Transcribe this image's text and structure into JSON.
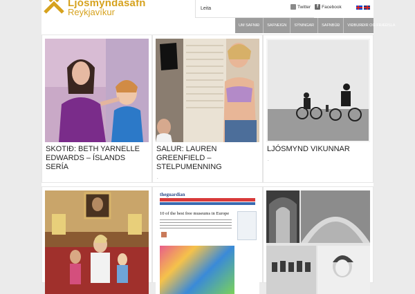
{
  "header": {
    "logo_line1": "Ljósmyndasafn",
    "logo_line2": "Reykjavíkur",
    "logo_color": "#d6a21e",
    "search_label": "Leita",
    "social": [
      {
        "label": "Twitter",
        "icon": "twitter-icon"
      },
      {
        "label": "Facebook",
        "icon": "facebook-icon"
      }
    ],
    "languages": [
      "is-flag-icon",
      "en-flag-icon"
    ]
  },
  "nav": {
    "items": [
      "UM SAFNIÐ",
      "SAFNEIGN",
      "SÝNINGAR",
      "SAFNBÚÐ",
      "VIÐBURÐIR OG FRÆÐSLA"
    ],
    "bg": "#9c9c9c"
  },
  "tiles": [
    {
      "title": "SKOTIÐ: BETH YARNELLE EDWARDS – ÍSLANDS SERÍA",
      "dot": "."
    },
    {
      "title": "SALUR: LAUREN GREENFIELD – STELPUMENNING",
      "dot": "."
    },
    {
      "title": "LJÓSMYND VIKUNNAR",
      "dot": "."
    },
    {
      "title": "",
      "dot": ""
    },
    {
      "title": "",
      "dot": ""
    },
    {
      "title": "",
      "dot": ""
    }
  ],
  "article_preview": {
    "masthead": "theguardian",
    "headline": "10 of the best free museums in Europe"
  }
}
